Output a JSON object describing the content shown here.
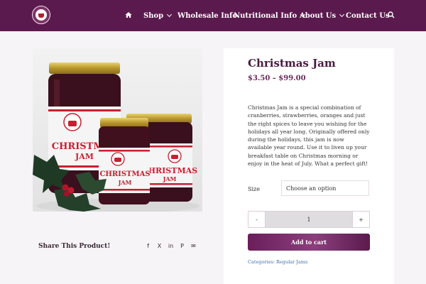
{
  "nav": {
    "items": [
      {
        "label": "Shop",
        "dropdown": true
      },
      {
        "label": "Wholesale Info",
        "dropdown": false
      },
      {
        "label": "Nutritional Info",
        "dropdown": true
      },
      {
        "label": "About Us",
        "dropdown": true
      },
      {
        "label": "Contact Us",
        "dropdown": false
      }
    ],
    "icons": [
      "home-icon",
      "search-icon"
    ]
  },
  "product_image": {
    "jar_labels": [
      "CHRISTMAS",
      "JAM",
      "CHRISTMAS",
      "JAM",
      "CHRISTMAS",
      "JAM"
    ]
  },
  "product": {
    "title": "Christmas Jam",
    "price": "$3.50 – $99.00",
    "description": "Christmas Jam is a special combination of cranberries, strawberries, oranges and just the right spices to leave you wishing for the holidays all year long. Originally offered only during the holidays, this jam is now available year round. Use it to liven up your breakfast table on Christmas morning or enjoy in the heat of July. What a perfect gift!",
    "size_label": "Size",
    "size_selected": "Choose an option",
    "qty_minus": "-",
    "qty_value": "1",
    "qty_plus": "+",
    "add_to_cart": "Add to cart",
    "categories": "Categories: Regular Jams"
  },
  "share": {
    "label": "Share This Product!",
    "icons": [
      {
        "name": "facebook-icon",
        "glyph": "f"
      },
      {
        "name": "x-icon",
        "glyph": "X"
      },
      {
        "name": "linkedin-icon",
        "glyph": "in"
      },
      {
        "name": "pinterest-icon",
        "glyph": "P"
      },
      {
        "name": "email-icon",
        "glyph": "✉"
      }
    ]
  },
  "colors": {
    "header_bg": "#5b1a4d",
    "accent": "#6b2a5b",
    "link": "#3c6fa8"
  }
}
